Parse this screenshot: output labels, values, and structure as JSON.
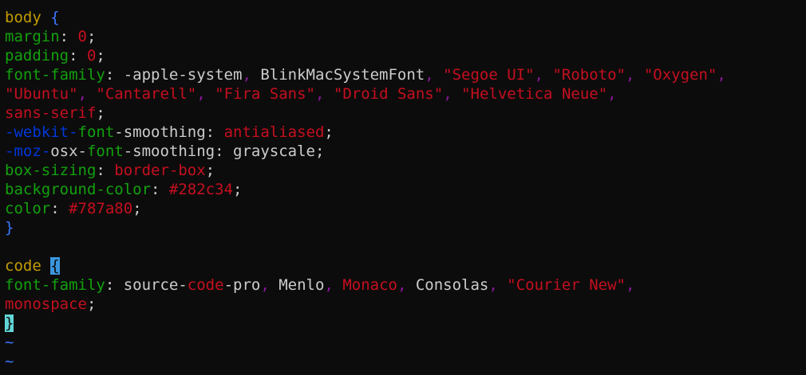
{
  "editor": {
    "lines": [
      [
        {
          "t": "body",
          "c": "selector"
        },
        {
          "t": " ",
          "c": "plain"
        },
        {
          "t": "{",
          "c": "brace"
        }
      ],
      [
        {
          "t": "margin",
          "c": "prop"
        },
        {
          "t": ": ",
          "c": "plain"
        },
        {
          "t": "0",
          "c": "num"
        },
        {
          "t": ";",
          "c": "plain"
        }
      ],
      [
        {
          "t": "padding",
          "c": "prop"
        },
        {
          "t": ": ",
          "c": "plain"
        },
        {
          "t": "0",
          "c": "num"
        },
        {
          "t": ";",
          "c": "plain"
        }
      ],
      [
        {
          "t": "font-family",
          "c": "prop"
        },
        {
          "t": ": -apple-system",
          "c": "plain"
        },
        {
          "t": ",",
          "c": "punct"
        },
        {
          "t": " BlinkMacSystemFont",
          "c": "plain"
        },
        {
          "t": ",",
          "c": "punct"
        },
        {
          "t": " ",
          "c": "plain"
        },
        {
          "t": "\"Segoe UI\"",
          "c": "str"
        },
        {
          "t": ",",
          "c": "punct"
        },
        {
          "t": " ",
          "c": "plain"
        },
        {
          "t": "\"Roboto\"",
          "c": "str"
        },
        {
          "t": ",",
          "c": "punct"
        },
        {
          "t": " ",
          "c": "plain"
        },
        {
          "t": "\"Oxygen\"",
          "c": "str"
        },
        {
          "t": ",",
          "c": "punct"
        }
      ],
      [
        {
          "t": "\"Ubuntu\"",
          "c": "str"
        },
        {
          "t": ",",
          "c": "punct"
        },
        {
          "t": " ",
          "c": "plain"
        },
        {
          "t": "\"Cantarell\"",
          "c": "str"
        },
        {
          "t": ",",
          "c": "punct"
        },
        {
          "t": " ",
          "c": "plain"
        },
        {
          "t": "\"Fira Sans\"",
          "c": "str"
        },
        {
          "t": ",",
          "c": "punct"
        },
        {
          "t": " ",
          "c": "plain"
        },
        {
          "t": "\"Droid Sans\"",
          "c": "str"
        },
        {
          "t": ",",
          "c": "punct"
        },
        {
          "t": " ",
          "c": "plain"
        },
        {
          "t": "\"Helvetica Neue\"",
          "c": "str"
        },
        {
          "t": ",",
          "c": "punct"
        }
      ],
      [
        {
          "t": "sans-serif",
          "c": "str"
        },
        {
          "t": ";",
          "c": "plain"
        }
      ],
      [
        {
          "t": "-webkit-",
          "c": "vendor"
        },
        {
          "t": "font",
          "c": "prop"
        },
        {
          "t": "-smoothing: ",
          "c": "plain"
        },
        {
          "t": "antialiased",
          "c": "str"
        },
        {
          "t": ";",
          "c": "plain"
        }
      ],
      [
        {
          "t": "-moz-",
          "c": "vendor"
        },
        {
          "t": "osx-",
          "c": "plain"
        },
        {
          "t": "font",
          "c": "prop"
        },
        {
          "t": "-smoothing: grayscale;",
          "c": "plain"
        }
      ],
      [
        {
          "t": "box-sizing",
          "c": "prop"
        },
        {
          "t": ": ",
          "c": "plain"
        },
        {
          "t": "border-box",
          "c": "str"
        },
        {
          "t": ";",
          "c": "plain"
        }
      ],
      [
        {
          "t": "background-color",
          "c": "prop"
        },
        {
          "t": ": ",
          "c": "plain"
        },
        {
          "t": "#282c34",
          "c": "num"
        },
        {
          "t": ";",
          "c": "plain"
        }
      ],
      [
        {
          "t": "color",
          "c": "prop"
        },
        {
          "t": ": ",
          "c": "plain"
        },
        {
          "t": "#787a80",
          "c": "num"
        },
        {
          "t": ";",
          "c": "plain"
        }
      ],
      [
        {
          "t": "}",
          "c": "brace"
        }
      ],
      [],
      [
        {
          "t": "code",
          "c": "selector"
        },
        {
          "t": " ",
          "c": "plain"
        },
        {
          "t": "{",
          "c": "brace-hl"
        }
      ],
      [
        {
          "t": "font-family",
          "c": "prop"
        },
        {
          "t": ": source-",
          "c": "plain"
        },
        {
          "t": "code",
          "c": "num"
        },
        {
          "t": "-pro",
          "c": "plain"
        },
        {
          "t": ",",
          "c": "punct"
        },
        {
          "t": " Menlo",
          "c": "plain"
        },
        {
          "t": ",",
          "c": "punct"
        },
        {
          "t": " ",
          "c": "plain"
        },
        {
          "t": "Monaco",
          "c": "str"
        },
        {
          "t": ",",
          "c": "punct"
        },
        {
          "t": " Consolas",
          "c": "plain"
        },
        {
          "t": ",",
          "c": "punct"
        },
        {
          "t": " ",
          "c": "plain"
        },
        {
          "t": "\"Courier New\"",
          "c": "str"
        },
        {
          "t": ",",
          "c": "punct"
        }
      ],
      [
        {
          "t": "monospace",
          "c": "str"
        },
        {
          "t": ";",
          "c": "plain"
        }
      ],
      [
        {
          "t": "}",
          "c": "cursor-hl"
        }
      ],
      [
        {
          "t": "~",
          "c": "tilde"
        }
      ],
      [
        {
          "t": "~",
          "c": "tilde"
        }
      ]
    ]
  }
}
